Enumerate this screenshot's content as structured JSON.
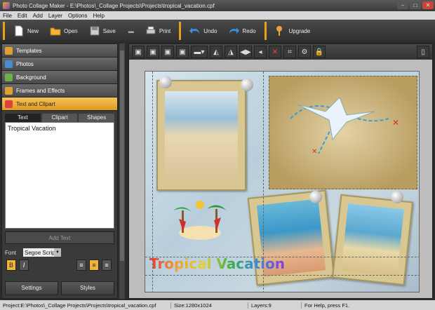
{
  "window": {
    "title": "Photo Collage Maker - E:\\Photos\\_Collage Projects\\Projects\\tropical_vacation.cpf",
    "min": "–",
    "max": "□",
    "close": "✕"
  },
  "menu": [
    "File",
    "Edit",
    "Add",
    "Layer",
    "Options",
    "Help"
  ],
  "toolbar": {
    "new": "New",
    "open": "Open",
    "save": "Save",
    "print": "Print",
    "undo": "Undo",
    "redo": "Redo",
    "upgrade": "Upgrade"
  },
  "sidebar": {
    "sections": [
      {
        "label": "Templates",
        "icon": "star-icon",
        "color": "#e0a030"
      },
      {
        "label": "Photos",
        "icon": "photo-icon",
        "color": "#4a8ad0"
      },
      {
        "label": "Background",
        "icon": "background-icon",
        "color": "#6ab04a"
      },
      {
        "label": "Frames and Effects",
        "icon": "frames-icon",
        "color": "#e0a030"
      },
      {
        "label": "Text and Clipart",
        "icon": "text-clipart-icon",
        "color": "#e04040"
      }
    ],
    "tabs": [
      "Text",
      "Clipart",
      "Shapes"
    ],
    "text_value": "Tropical Vacation",
    "add_text": "Add Text",
    "font_label": "Font",
    "font_value": "Segoe Script",
    "bold": "B",
    "italic": "I",
    "settings": "Settings",
    "styles": "Styles"
  },
  "canvas": {
    "collage_text": "Tropical Vacation"
  },
  "status": {
    "project": "Project:E:\\Photos\\_Collage Projects\\Projects\\tropical_vacation.cpf",
    "size": "Size:1280x1024",
    "layers": "Layers:9",
    "help": "For Help, press F1."
  }
}
